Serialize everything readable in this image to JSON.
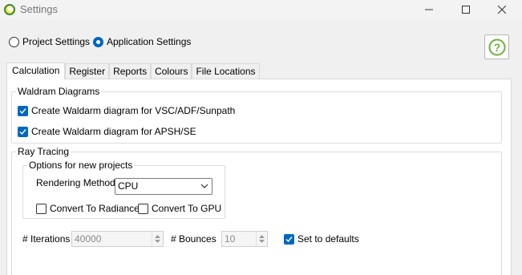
{
  "window": {
    "title": "Settings"
  },
  "scope": {
    "project_label": "Project Settings",
    "application_label": "Application Settings",
    "selected": "application"
  },
  "tabs": [
    {
      "label": "Calculation",
      "active": true
    },
    {
      "label": "Register",
      "active": false
    },
    {
      "label": "Reports",
      "active": false
    },
    {
      "label": "Colours",
      "active": false
    },
    {
      "label": "File Locations",
      "active": false
    }
  ],
  "waldram": {
    "group_label": "Waldram Diagrams",
    "vsc_label": "Create Waldarm diagram for VSC/ADF/Sunpath",
    "vsc_checked": true,
    "apsh_label": "Create Waldarm diagram for APSH/SE",
    "apsh_checked": true
  },
  "ray_tracing": {
    "group_label": "Ray Tracing",
    "options_group_label": "Options for new projects",
    "rendering_method_label": "Rendering Method",
    "rendering_method_value": "CPU",
    "convert_radiance_label": "Convert To Radiance",
    "convert_radiance_checked": false,
    "convert_gpu_label": "Convert To GPU",
    "convert_gpu_checked": false,
    "iterations_label": "# Iterations",
    "iterations_value": "40000",
    "bounces_label": "# Bounces",
    "bounces_value": "10",
    "defaults_label": "Set to defaults",
    "defaults_checked": true
  },
  "colors": {
    "accent": "#0067c0",
    "help_green": "#6bb23a"
  },
  "icons": {
    "app": "app-logo-icon",
    "minimize": "minimize-icon",
    "maximize": "maximize-icon",
    "close": "close-icon",
    "help": "help-icon",
    "check": "checkmark-icon",
    "dropdown": "chevron-down-icon",
    "spin_up": "spin-up-icon",
    "spin_down": "spin-down-icon"
  }
}
